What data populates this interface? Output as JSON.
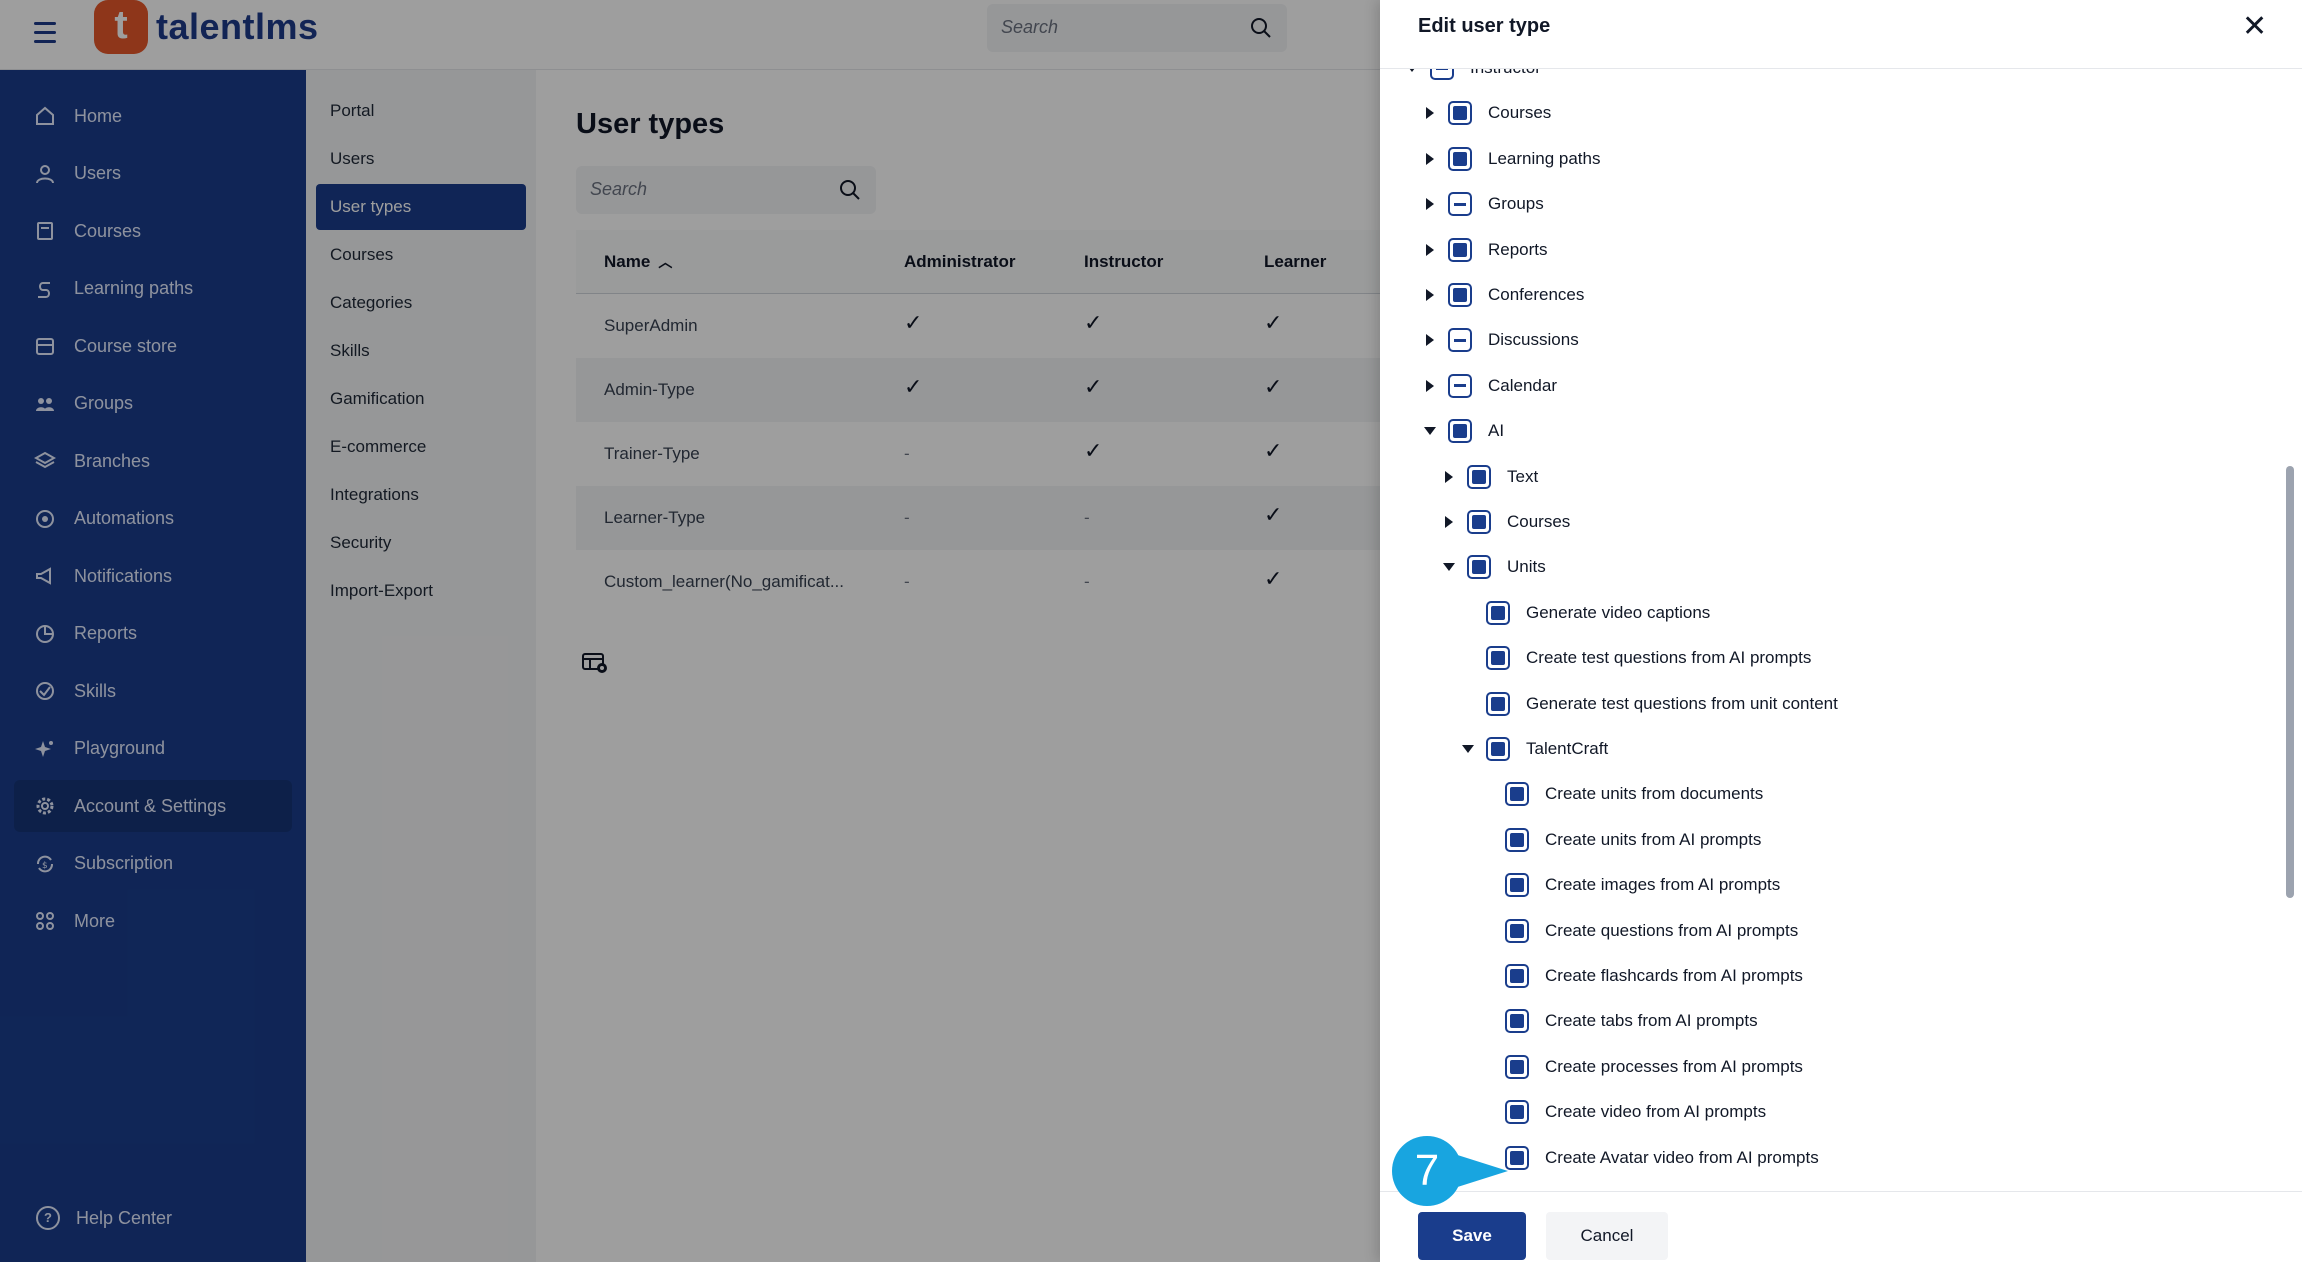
{
  "app": {
    "logo_letter": "t",
    "logo_text": "talentlms"
  },
  "topbar": {
    "search_placeholder": "Search"
  },
  "sidebar": {
    "items": [
      {
        "label": "Home",
        "icon": "home-icon"
      },
      {
        "label": "Users",
        "icon": "user-icon"
      },
      {
        "label": "Courses",
        "icon": "book-icon"
      },
      {
        "label": "Learning paths",
        "icon": "path-icon"
      },
      {
        "label": "Course store",
        "icon": "store-icon"
      },
      {
        "label": "Groups",
        "icon": "groups-icon"
      },
      {
        "label": "Branches",
        "icon": "layers-icon"
      },
      {
        "label": "Automations",
        "icon": "automation-icon"
      },
      {
        "label": "Notifications",
        "icon": "megaphone-icon"
      },
      {
        "label": "Reports",
        "icon": "pie-chart-icon"
      },
      {
        "label": "Skills",
        "icon": "skills-icon"
      },
      {
        "label": "Playground",
        "icon": "sparkle-icon"
      },
      {
        "label": "Account & Settings",
        "icon": "gear-icon",
        "active": true
      },
      {
        "label": "Subscription",
        "icon": "refresh-dollar-icon"
      },
      {
        "label": "More",
        "icon": "grid-icon"
      }
    ],
    "help_label": "Help Center"
  },
  "subnav": {
    "items": [
      "Portal",
      "Users",
      "User types",
      "Courses",
      "Categories",
      "Skills",
      "Gamification",
      "E-commerce",
      "Integrations",
      "Security",
      "Import-Export"
    ],
    "active_index": 2
  },
  "main": {
    "title": "User types",
    "search_placeholder": "Search",
    "columns": [
      "Name",
      "Administrator",
      "Instructor",
      "Learner"
    ],
    "rows": [
      {
        "name": "SuperAdmin",
        "admin": "✓",
        "instructor": "✓",
        "learner": "✓"
      },
      {
        "name": "Admin-Type",
        "admin": "✓",
        "instructor": "✓",
        "learner": "✓"
      },
      {
        "name": "Trainer-Type",
        "admin": "-",
        "instructor": "✓",
        "learner": "✓"
      },
      {
        "name": "Learner-Type",
        "admin": "-",
        "instructor": "-",
        "learner": "✓"
      },
      {
        "name": "Custom_learner(No_gamificat...",
        "admin": "-",
        "instructor": "-",
        "learner": "✓"
      }
    ]
  },
  "drawer": {
    "title": "Edit user type",
    "save_label": "Save",
    "cancel_label": "Cancel",
    "tree": [
      {
        "label": "Instructor",
        "level": 0,
        "caret": "down",
        "state": "partial"
      },
      {
        "label": "Courses",
        "level": 1,
        "caret": "right",
        "state": "full"
      },
      {
        "label": "Learning paths",
        "level": 1,
        "caret": "right",
        "state": "full"
      },
      {
        "label": "Groups",
        "level": 1,
        "caret": "right",
        "state": "partial"
      },
      {
        "label": "Reports",
        "level": 1,
        "caret": "right",
        "state": "full"
      },
      {
        "label": "Conferences",
        "level": 1,
        "caret": "right",
        "state": "full"
      },
      {
        "label": "Discussions",
        "level": 1,
        "caret": "right",
        "state": "partial"
      },
      {
        "label": "Calendar",
        "level": 1,
        "caret": "right",
        "state": "partial"
      },
      {
        "label": "AI",
        "level": 1,
        "caret": "down",
        "state": "full"
      },
      {
        "label": "Text",
        "level": 2,
        "caret": "right",
        "state": "full"
      },
      {
        "label": "Courses",
        "level": 2,
        "caret": "right",
        "state": "full"
      },
      {
        "label": "Units",
        "level": 2,
        "caret": "down",
        "state": "full"
      },
      {
        "label": "Generate video captions",
        "level": 3,
        "caret": "none",
        "state": "full"
      },
      {
        "label": "Create test questions from AI prompts",
        "level": 3,
        "caret": "none",
        "state": "full"
      },
      {
        "label": "Generate test questions from unit content",
        "level": 3,
        "caret": "none",
        "state": "full"
      },
      {
        "label": "TalentCraft",
        "level": 3,
        "caret": "down",
        "state": "full"
      },
      {
        "label": "Create units from documents",
        "level": 4,
        "caret": "none",
        "state": "full"
      },
      {
        "label": "Create units from AI prompts",
        "level": 4,
        "caret": "none",
        "state": "full"
      },
      {
        "label": "Create images from AI prompts",
        "level": 4,
        "caret": "none",
        "state": "full"
      },
      {
        "label": "Create questions from AI prompts",
        "level": 4,
        "caret": "none",
        "state": "full"
      },
      {
        "label": "Create flashcards from AI prompts",
        "level": 4,
        "caret": "none",
        "state": "full"
      },
      {
        "label": "Create tabs from AI prompts",
        "level": 4,
        "caret": "none",
        "state": "full"
      },
      {
        "label": "Create processes from AI prompts",
        "level": 4,
        "caret": "none",
        "state": "full"
      },
      {
        "label": "Create video from AI prompts",
        "level": 4,
        "caret": "none",
        "state": "full"
      },
      {
        "label": "Create Avatar video from AI prompts",
        "level": 4,
        "caret": "none",
        "state": "full"
      }
    ]
  },
  "annotation": {
    "step_number": "7",
    "color": "#18a5e0"
  },
  "colors": {
    "brand_blue": "#1a3d8c",
    "logo_orange": "#e5572a"
  }
}
